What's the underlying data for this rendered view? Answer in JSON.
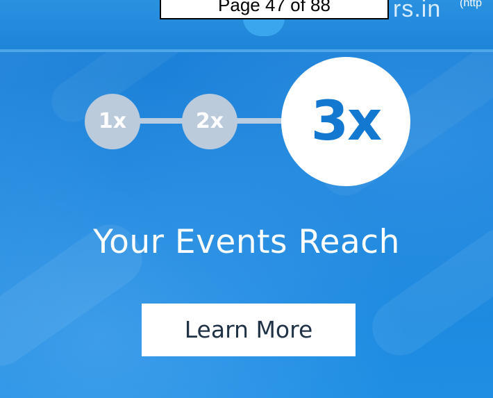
{
  "header": {
    "page_indicator": "Page 47 of 88",
    "brand_fragment": "rs.in",
    "link_fragment": "(http"
  },
  "ad": {
    "steps": [
      {
        "label": "1x",
        "state": "inactive"
      },
      {
        "label": "2x",
        "state": "inactive"
      },
      {
        "label": "3x",
        "state": "active"
      }
    ],
    "headline": "Your Events Reach",
    "cta_label": "Learn More"
  },
  "colors": {
    "background": "#1f86d9",
    "active_step": "#ffffff",
    "active_step_text": "#1378cf",
    "inactive_step": "#bccbdb",
    "cta_background": "#ffffff",
    "cta_text": "#203246"
  }
}
